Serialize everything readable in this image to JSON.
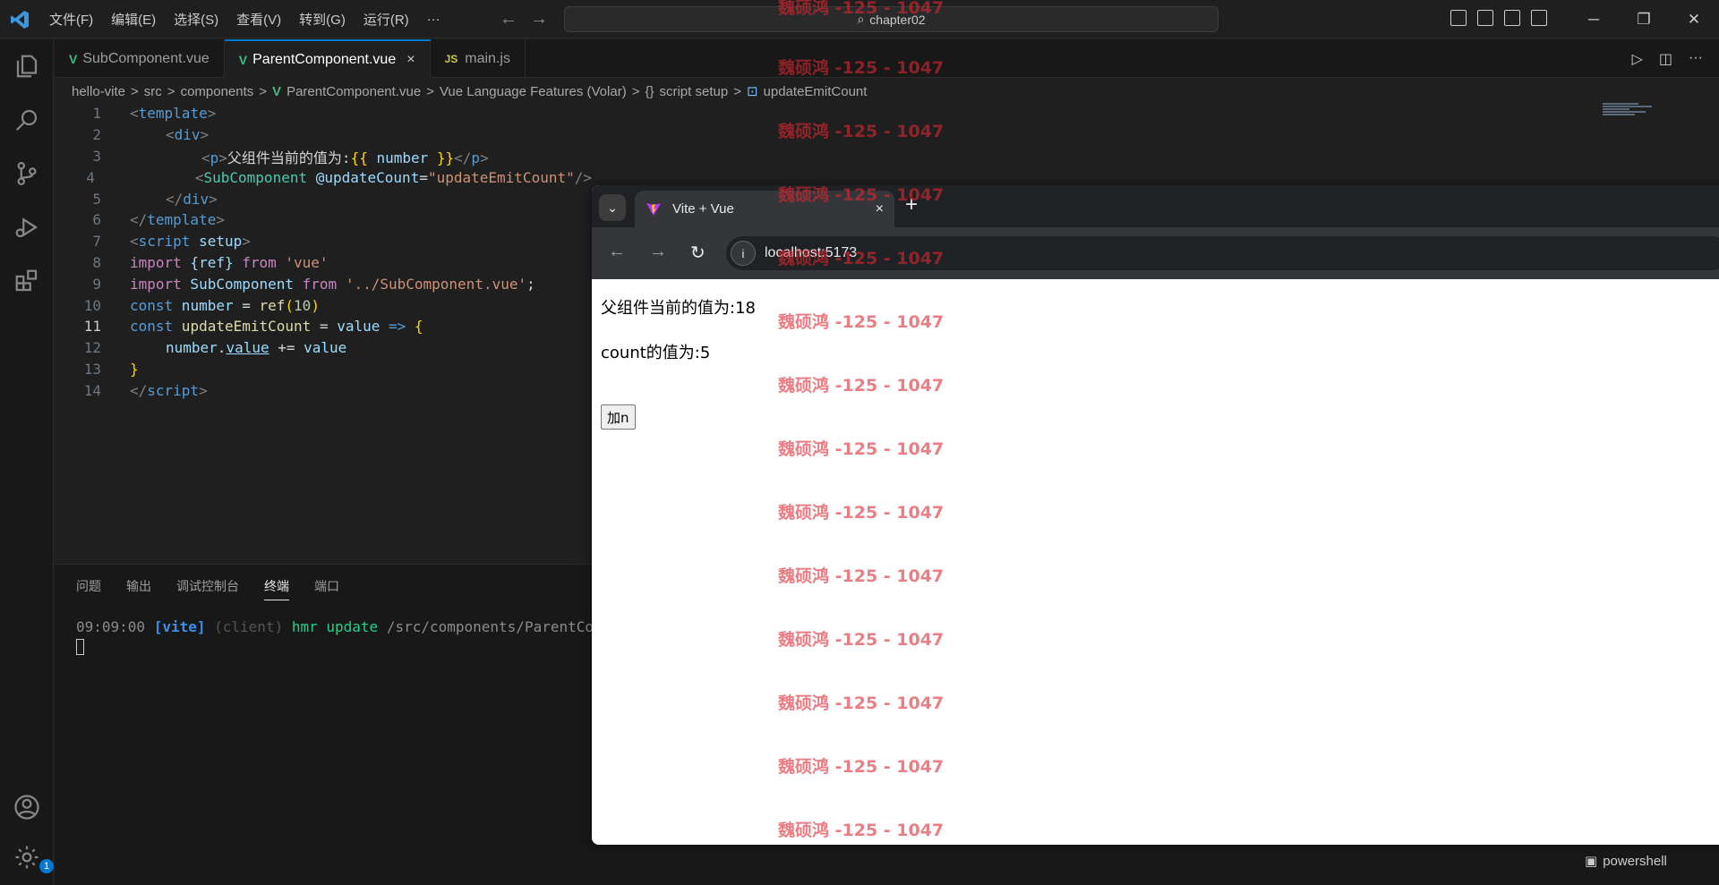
{
  "menu": [
    "文件(F)",
    "编辑(E)",
    "选择(S)",
    "查看(V)",
    "转到(G)",
    "运行(R)",
    "···"
  ],
  "command_center": {
    "text": "chapter02",
    "icon": "search-icon"
  },
  "tabs": [
    {
      "label": "SubComponent.vue",
      "icon": "vue-icon",
      "active": false
    },
    {
      "label": "ParentComponent.vue",
      "icon": "vue-icon",
      "active": true
    },
    {
      "label": "main.js",
      "icon": "js-icon",
      "active": false
    }
  ],
  "tab_icon_text": {
    "js": "JS",
    "close": "×"
  },
  "breadcrumb": [
    "hello-vite",
    "src",
    "components",
    "ParentComponent.vue",
    "Vue Language Features (Volar)",
    "script setup",
    "updateEmitCount"
  ],
  "breadcrumb_symbols": {
    "braces": "{}",
    "sep": ">"
  },
  "code": {
    "line_numbers": [
      "1",
      "2",
      "3",
      "4",
      "5",
      "6",
      "7",
      "8",
      "9",
      "10",
      "11",
      "12",
      "13",
      "14"
    ],
    "l1": [
      "<",
      "template",
      ">"
    ],
    "l2": [
      "<",
      "div",
      ">"
    ],
    "l3": [
      "<",
      "p",
      ">",
      "父组件当前的值为:",
      "{{",
      " number ",
      "}}",
      "</",
      "p",
      ">"
    ],
    "l4": [
      "<",
      "SubComponent",
      " @updateCount",
      "=",
      "\"updateEmitCount\"",
      "/>"
    ],
    "l5": [
      "</",
      "div",
      ">"
    ],
    "l6": [
      "</",
      "template",
      ">"
    ],
    "l7": [
      "<",
      "script",
      " setup",
      ">"
    ],
    "l8": [
      "import",
      " {ref} ",
      "from",
      " 'vue'"
    ],
    "l9": [
      "import",
      " SubComponent ",
      "from",
      " '../SubComponent.vue'",
      ";"
    ],
    "l10": [
      "const",
      " number ",
      "= ",
      "ref",
      "(",
      "10",
      ")"
    ],
    "l11": [
      "const",
      " updateEmitCount ",
      "= ",
      "value",
      " => ",
      "{"
    ],
    "l12": [
      "number",
      ".",
      "value",
      " += ",
      "value"
    ],
    "l13": [
      "}"
    ],
    "l14": [
      "</",
      "script",
      ">"
    ]
  },
  "panel": {
    "tabs": [
      "问题",
      "输出",
      "调试控制台",
      "终端",
      "端口"
    ],
    "active_tab": "终端",
    "terminal": {
      "time": "09:09:00",
      "tag": "[vite]",
      "client": "(client)",
      "action": "hmr update",
      "path": "/src/components/ParentCompon"
    },
    "terminal_list_item": "powershell"
  },
  "browser": {
    "tab_title": "Vite + Vue",
    "url": "localhost:5173",
    "content": {
      "parent_value": "父组件当前的值为:18",
      "count_value": "count的值为:5",
      "button_label": "加n"
    }
  },
  "watermark": "魏硕鸿 -125 - 1047",
  "notification_badge": "1",
  "colors": {
    "accent": "#0078d4",
    "vue": "#41b883",
    "watermark": "#dc2832"
  }
}
